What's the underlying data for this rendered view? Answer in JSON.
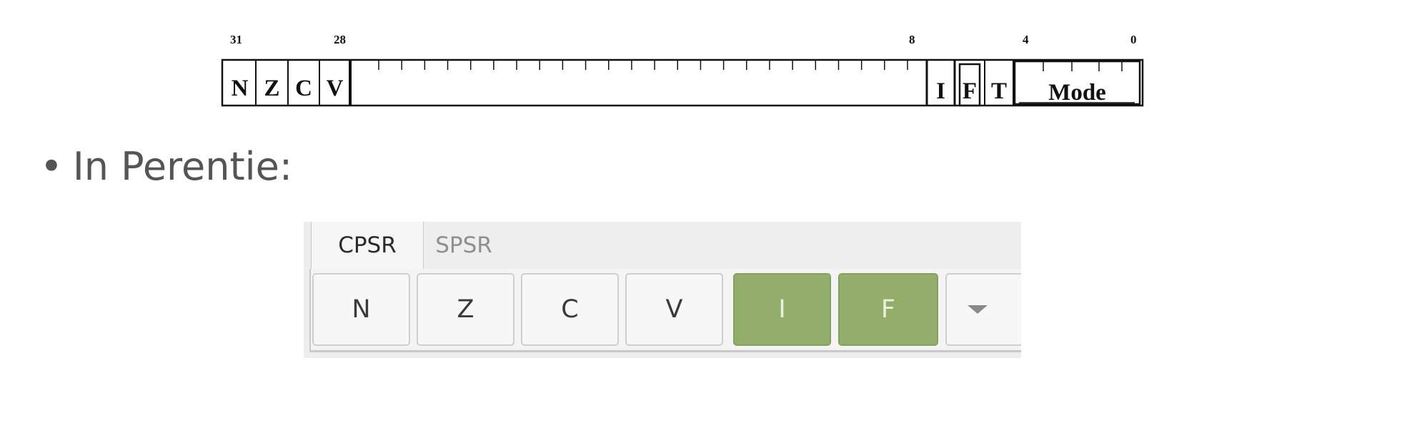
{
  "register_diagram": {
    "bit_numbers": [
      "31",
      "28",
      "8",
      "4",
      "0"
    ],
    "flags_high": [
      "N",
      "Z",
      "C",
      "V"
    ],
    "flags_low": [
      "I",
      "F",
      "T"
    ],
    "mode_label": "Mode"
  },
  "bullet": {
    "dot": "•",
    "text": "In Perentie:"
  },
  "perentie": {
    "tabs": [
      {
        "label": "CPSR",
        "active": true
      },
      {
        "label": "SPSR",
        "active": false
      }
    ],
    "flags": [
      {
        "label": "N",
        "set": false
      },
      {
        "label": "Z",
        "set": false
      },
      {
        "label": "C",
        "set": false
      },
      {
        "label": "V",
        "set": false
      },
      {
        "label": "I",
        "set": true
      },
      {
        "label": "F",
        "set": true
      }
    ],
    "dropdown_icon": "chevron-down-icon",
    "set_color": "#93ae6b"
  }
}
